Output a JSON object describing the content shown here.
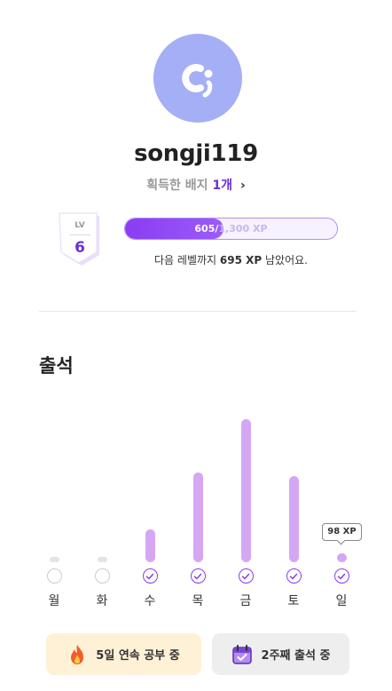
{
  "profile": {
    "username": "songji119",
    "badge_label": "획득한 배지",
    "badge_count": "1개",
    "chevron": "›"
  },
  "level": {
    "label": "LV",
    "value": "6"
  },
  "xp": {
    "current": "605",
    "separator": "/",
    "total": "1,300 XP",
    "progress_fraction": 0.465,
    "remaining_prefix": "다음 레벨까지 ",
    "remaining_value": "695 XP",
    "remaining_suffix": " 남았어요."
  },
  "attendance": {
    "title": "출석",
    "days": [
      {
        "label": "월",
        "level": 0,
        "done": false
      },
      {
        "label": "화",
        "level": 0,
        "done": false
      },
      {
        "label": "수",
        "level": 0.23,
        "done": true
      },
      {
        "label": "목",
        "level": 0.63,
        "done": true
      },
      {
        "label": "금",
        "level": 1.0,
        "done": true
      },
      {
        "label": "토",
        "level": 0.6,
        "done": true
      },
      {
        "label": "일",
        "level": 0.04,
        "done": true
      }
    ],
    "tooltip": "98 XP"
  },
  "streaks": {
    "days_label": "5일 연속 공부 중",
    "weeks_label": "2주째 출석 중"
  },
  "colors": {
    "accent": "#8a3cf2",
    "bar": "#d5a7f3",
    "avatar": "#a5aff5",
    "streak_bg": "#fff1d6"
  },
  "icons": {
    "avatar": "logo-icon",
    "streak": "fire-icon",
    "weeks": "calendar-check-icon",
    "check": "check-icon"
  }
}
